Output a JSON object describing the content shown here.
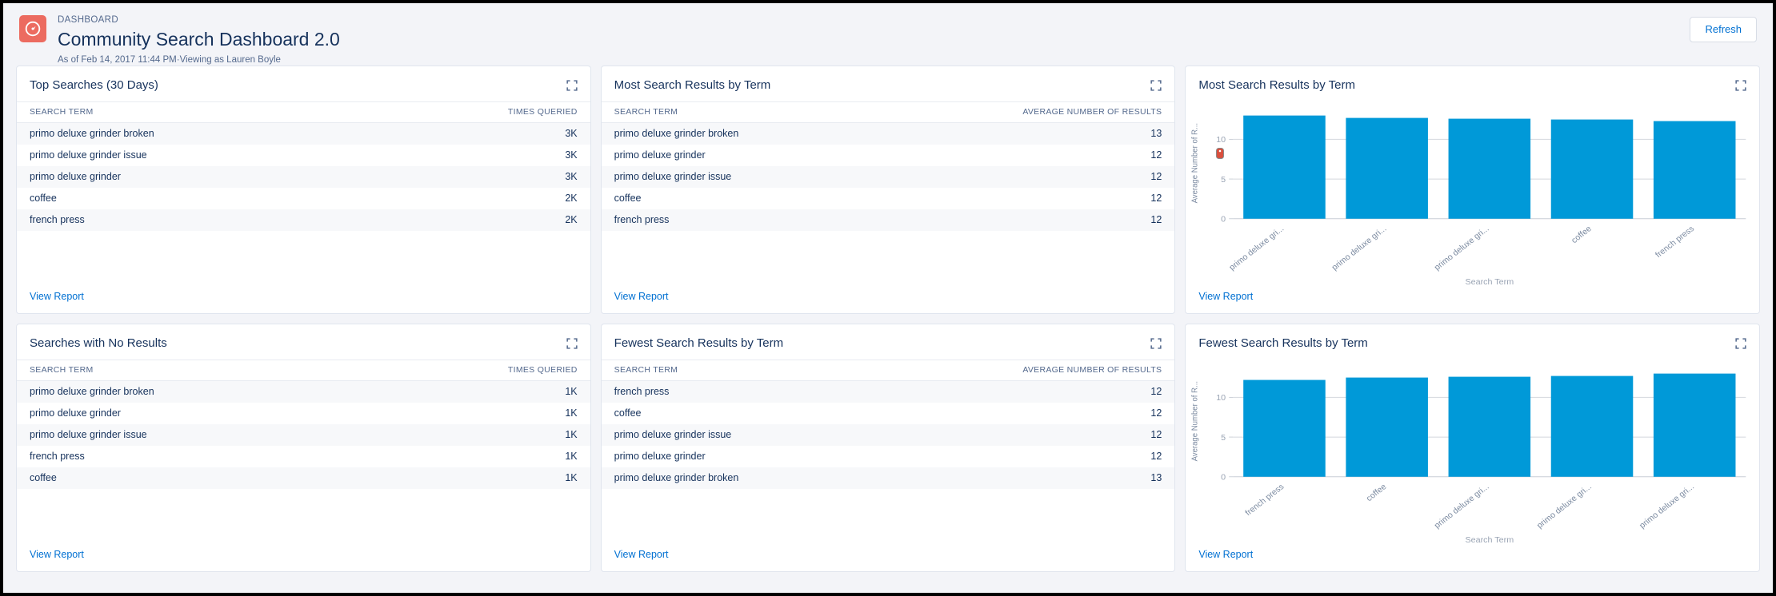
{
  "header": {
    "eyebrow": "DASHBOARD",
    "title": "Community Search Dashboard 2.0",
    "subtitle": "As of Feb 14, 2017 11:44 PM·Viewing as Lauren Boyle",
    "refresh_label": "Refresh",
    "icon": "dashboard-gauge-icon",
    "icon_color": "#ec6b60",
    "link_color": "#0070d2"
  },
  "common": {
    "view_report_label": "View Report",
    "expand_icon": "expand-icon"
  },
  "cards": [
    {
      "id": "top-searches",
      "title": "Top Searches (30 Days)",
      "type": "table",
      "columns": [
        "SEARCH TERM",
        "TIMES QUERIED"
      ],
      "rows": [
        [
          "primo deluxe grinder broken",
          "3K"
        ],
        [
          "primo deluxe grinder issue",
          "3K"
        ],
        [
          "primo deluxe grinder",
          "3K"
        ],
        [
          "coffee",
          "2K"
        ],
        [
          "french press",
          "2K"
        ]
      ]
    },
    {
      "id": "most-search-results-table",
      "title": "Most Search Results by Term",
      "type": "table",
      "columns": [
        "SEARCH TERM",
        "AVERAGE NUMBER OF RESULTS"
      ],
      "rows": [
        [
          "primo deluxe grinder broken",
          "13"
        ],
        [
          "primo deluxe grinder",
          "12"
        ],
        [
          "primo deluxe grinder issue",
          "12"
        ],
        [
          "coffee",
          "12"
        ],
        [
          "french press",
          "12"
        ]
      ]
    },
    {
      "id": "most-search-results-chart",
      "title": "Most Search Results by Term",
      "type": "chart"
    },
    {
      "id": "searches-with-no-results",
      "title": "Searches with No Results",
      "type": "table",
      "columns": [
        "SEARCH TERM",
        "TIMES QUERIED"
      ],
      "rows": [
        [
          "primo deluxe grinder broken",
          "1K"
        ],
        [
          "primo deluxe grinder",
          "1K"
        ],
        [
          "primo deluxe grinder issue",
          "1K"
        ],
        [
          "french press",
          "1K"
        ],
        [
          "coffee",
          "1K"
        ]
      ]
    },
    {
      "id": "fewest-search-results-table",
      "title": "Fewest Search Results by Term",
      "type": "table",
      "columns": [
        "SEARCH TERM",
        "AVERAGE NUMBER OF RESULTS"
      ],
      "rows": [
        [
          "french press",
          "12"
        ],
        [
          "coffee",
          "12"
        ],
        [
          "primo deluxe grinder issue",
          "12"
        ],
        [
          "primo deluxe grinder",
          "12"
        ],
        [
          "primo deluxe grinder broken",
          "13"
        ]
      ]
    },
    {
      "id": "fewest-search-results-chart",
      "title": "Fewest Search Results by Term",
      "type": "chart"
    }
  ],
  "chart_data": [
    {
      "id": "most-search-results-chart",
      "type": "bar",
      "title": "Most Search Results by Term",
      "categories": [
        "primo deluxe gri...",
        "primo deluxe gri...",
        "primo deluxe gri...",
        "coffee",
        "french press"
      ],
      "categories_full": [
        "primo deluxe grinder broken",
        "primo deluxe grinder",
        "primo deluxe grinder issue",
        "coffee",
        "french press"
      ],
      "values": [
        13,
        12.7,
        12.6,
        12.5,
        12.3
      ],
      "xlabel": "Search Term",
      "ylabel": "Average Number of R...",
      "ylabel_full": "Average Number of Results",
      "yticks": [
        0,
        5,
        10
      ],
      "ylim": [
        0,
        14
      ],
      "grid": true,
      "legend": "none",
      "bar_color": "#0099d8"
    },
    {
      "id": "fewest-search-results-chart",
      "type": "bar",
      "title": "Fewest Search Results by Term",
      "categories": [
        "french press",
        "coffee",
        "primo deluxe gri...",
        "primo deluxe gri...",
        "primo deluxe gri..."
      ],
      "categories_full": [
        "french press",
        "coffee",
        "primo deluxe grinder issue",
        "primo deluxe grinder",
        "primo deluxe grinder broken"
      ],
      "values": [
        12.2,
        12.5,
        12.6,
        12.7,
        13
      ],
      "xlabel": "Search Term",
      "ylabel": "Average Number of R...",
      "ylabel_full": "Average Number of Results",
      "yticks": [
        0,
        5,
        10
      ],
      "ylim": [
        0,
        14
      ],
      "grid": true,
      "legend": "none",
      "bar_color": "#0099d8"
    }
  ]
}
